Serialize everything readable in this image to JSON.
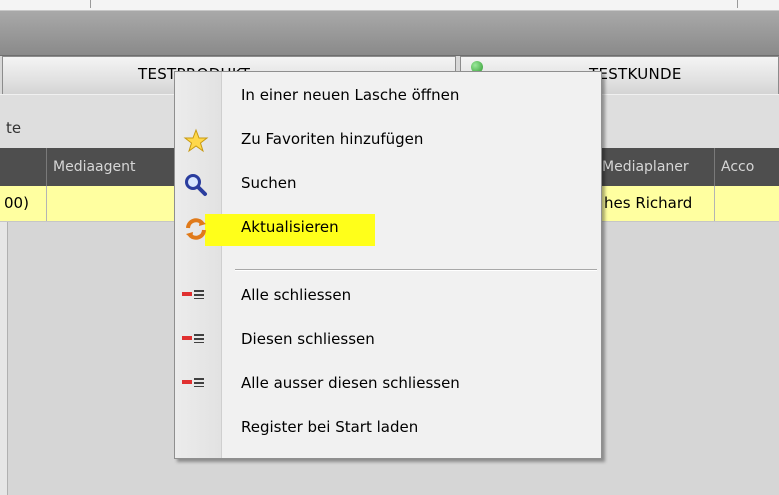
{
  "tabs": [
    {
      "label": "TESTPRODUKT"
    },
    {
      "label": "TESTKUNDE"
    }
  ],
  "toolbar": {
    "label": "te"
  },
  "grid": {
    "columns": [
      "",
      "Mediaagent",
      "Mediaplaner",
      "Acco"
    ],
    "rows": [
      {
        "cells": [
          "00)",
          "",
          "hes Richard",
          ""
        ]
      }
    ],
    "row_highlight_color": "#ffffa0"
  },
  "context_menu": {
    "items": [
      {
        "label": "In einer neuen Lasche öffnen",
        "icon": null
      },
      {
        "label": "Zu Favoriten hinzufügen",
        "icon": "star-icon"
      },
      {
        "label": "Suchen",
        "icon": "search-icon"
      },
      {
        "label": "Aktualisieren",
        "icon": "refresh-icon",
        "highlighted": true,
        "highlight_color": "#ffff1a"
      },
      {
        "label": "Alle schliessen",
        "icon": "close-tabs-icon"
      },
      {
        "label": "Diesen schliessen",
        "icon": "close-tabs-icon"
      },
      {
        "label": "Alle ausser diesen schliessen",
        "icon": "close-tabs-icon"
      },
      {
        "label": "Register bei Start laden",
        "icon": null
      }
    ]
  }
}
